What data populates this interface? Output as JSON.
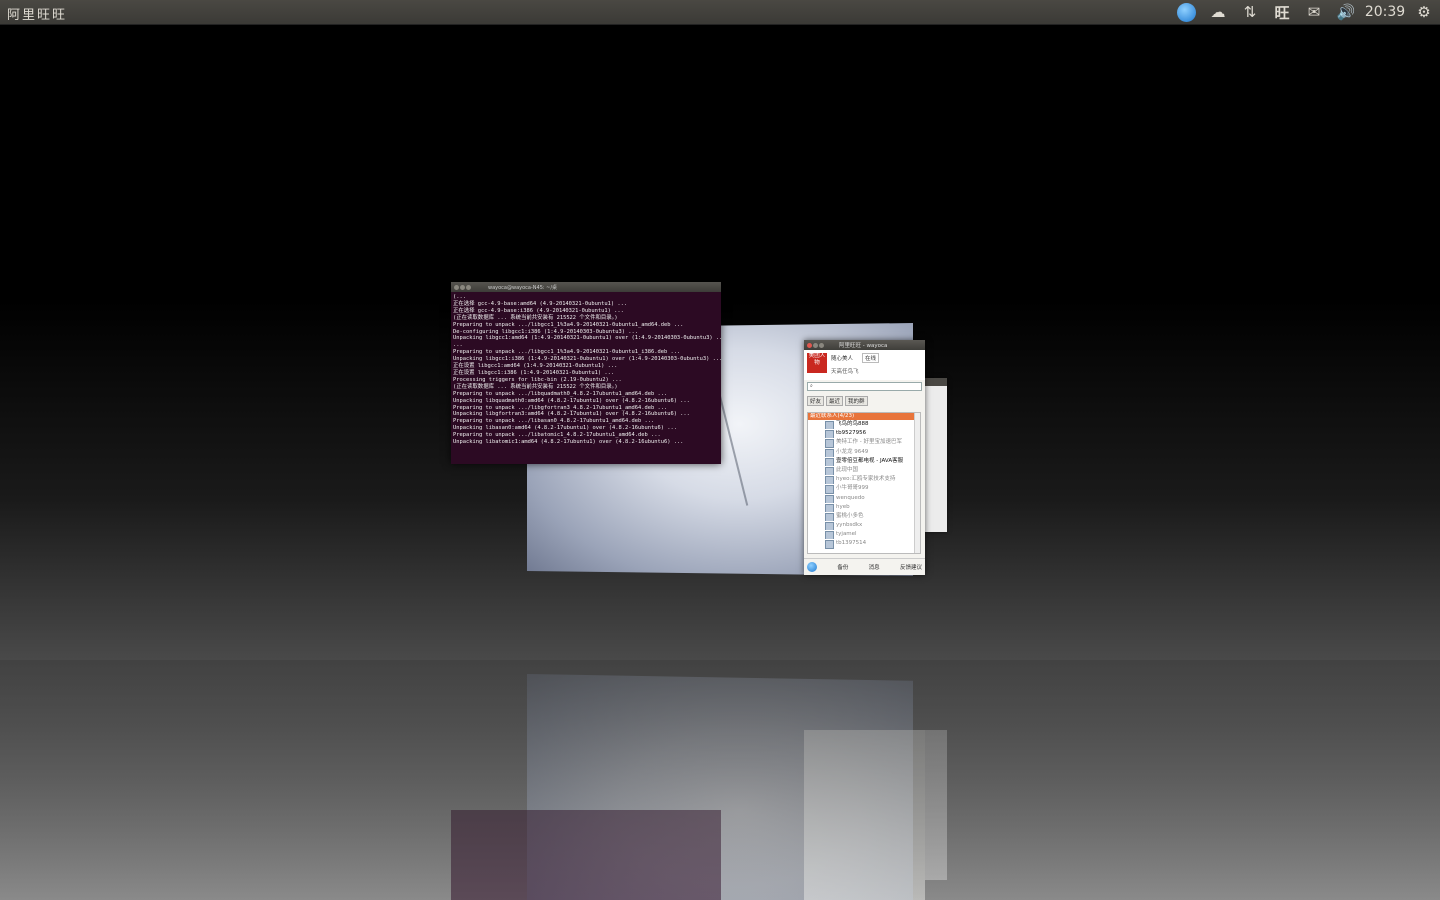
{
  "panel": {
    "app_title": "阿里旺旺",
    "clock": "20:39",
    "tray_icons": [
      "wangwang-icon",
      "cloud-icon",
      "network-icon",
      "red-app-icon",
      "mail-icon",
      "volume-icon",
      "power-icon"
    ],
    "glyphs": {
      "cloud": "☁",
      "network": "⇅",
      "red": "旺",
      "mail": "✉",
      "volume": "🔊",
      "power": "⚙"
    }
  },
  "terminal": {
    "title": "wayoca@wayoca-N45: ~/桌",
    "lines": [
      "(...",
      "正在选择 gcc-4.9-base:amd64 (4.9-20140321-0ubuntu1) ...",
      "正在选择 gcc-4.9-base:i386 (4.9-20140321-0ubuntu1) ...",
      "(正在读取数据库 ... 系统当前共安装有 215522 个文件和目录。)",
      "Preparing to unpack .../libgcc1_1%3a4.9-20140321-0ubuntu1_amd64.deb ...",
      "De-configuring libgcc1:i386 (1:4.9-20140303-0ubuntu3) ...",
      "Unpacking libgcc1:amd64 (1:4.9-20140321-0ubuntu1) over (1:4.9-20140303-0ubuntu3) ...",
      "...",
      "Preparing to unpack .../libgcc1_1%3a4.9-20140321-0ubuntu1_i386.deb ...",
      "Unpacking libgcc1:i386 (1:4.9-20140321-0ubuntu1) over (1:4.9-20140303-0ubuntu3) ...",
      "",
      "正在设置 libgcc1:amd64 (1:4.9-20140321-0ubuntu1) ...",
      "正在设置 libgcc1:i386 (1:4.9-20140321-0ubuntu1) ...",
      "Processing triggers for libc-bin (2.19-0ubuntu2) ...",
      "(正在读取数据库 ... 系统当前共安装有 215522 个文件和目录。)",
      "Preparing to unpack .../libquadmath0_4.8.2-17ubuntu1_amd64.deb ...",
      "Unpacking libquadmath0:amd64 (4.8.2-17ubuntu1) over (4.8.2-16ubuntu6) ...",
      "Preparing to unpack .../libgfortran3_4.8.2-17ubuntu1_amd64.deb ...",
      "Unpacking libgfortran3:amd64 (4.8.2-17ubuntu1) over (4.8.2-16ubuntu6) ...",
      "Preparing to unpack .../libasan0_4.8.2-17ubuntu1_amd64.deb ...",
      "Unpacking libasan0:amd64 (4.8.2-17ubuntu1) over (4.8.2-16ubuntu6) ...",
      "Preparing to unpack .../libatomic1_4.8.2-17ubuntu1_amd64.deb ...",
      "Unpacking libatomic1:amd64 (4.8.2-17ubuntu1) over (4.8.2-16ubuntu6) ..."
    ]
  },
  "im": {
    "title": "阿里旺旺 - wayoca",
    "avatar_text": "美团人物",
    "name": "随心美人",
    "status": "在线",
    "signature": "天高任鸟飞",
    "search_placeholder": "",
    "tabs": [
      "好友",
      "最近",
      "我的群"
    ],
    "group": "最近联系人(4/23)",
    "contacts": [
      {
        "name": "飞鸟的鸟888",
        "status": "online"
      },
      {
        "name": "tb9527956",
        "status": "online"
      },
      {
        "name": "美特工作 - 好里宝加速巴军",
        "status": "offline"
      },
      {
        "name": "小龙龙 9649",
        "status": "offline"
      },
      {
        "name": "壹零倍豆都电视 - JAVA客服",
        "status": "online"
      },
      {
        "name": "此现中国",
        "status": "offline"
      },
      {
        "name": "hyeo:汇鸥专家技术支持",
        "status": "offline"
      },
      {
        "name": "小牛哥哥999",
        "status": "offline"
      },
      {
        "name": "wenquedo",
        "status": "offline"
      },
      {
        "name": "hyeb",
        "status": "offline"
      },
      {
        "name": "蜜桃小多色",
        "status": "offline"
      },
      {
        "name": "yynbsdkx",
        "status": "offline"
      },
      {
        "name": "tyjamel",
        "status": "offline"
      },
      {
        "name": "tb1397514",
        "status": "offline"
      }
    ],
    "footer": {
      "inbox": "备份",
      "messages": "消息",
      "feedback": "反馈建议"
    }
  }
}
